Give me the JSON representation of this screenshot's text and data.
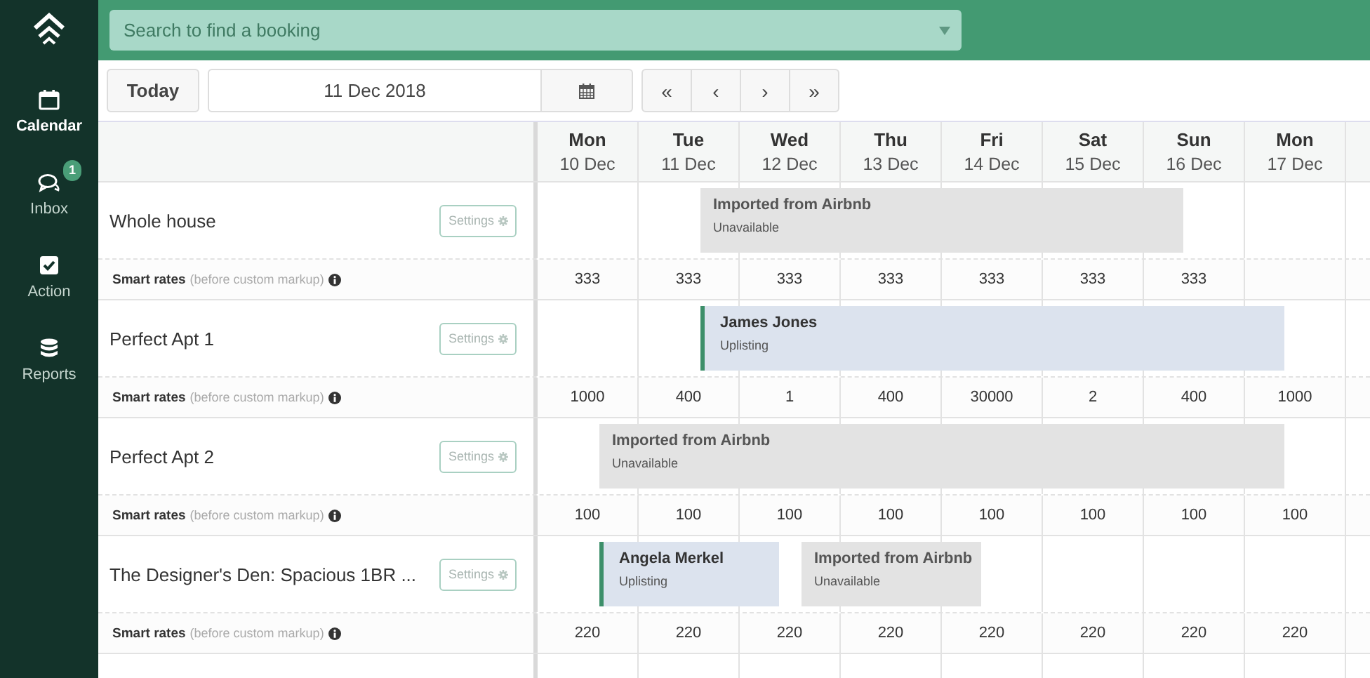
{
  "sidebar": {
    "items": [
      {
        "label": "Calendar",
        "selected": true
      },
      {
        "label": "Inbox",
        "selected": false,
        "badge": "1"
      },
      {
        "label": "Action",
        "selected": false
      },
      {
        "label": "Reports",
        "selected": false
      }
    ]
  },
  "search": {
    "placeholder": "Search to find a booking"
  },
  "toolbar": {
    "today": "Today",
    "date": "11 Dec 2018",
    "nav": [
      "«",
      "‹",
      "›",
      "»"
    ]
  },
  "days": [
    {
      "weekday": "Mon",
      "date": "10 Dec"
    },
    {
      "weekday": "Tue",
      "date": "11 Dec"
    },
    {
      "weekday": "Wed",
      "date": "12 Dec"
    },
    {
      "weekday": "Thu",
      "date": "13 Dec"
    },
    {
      "weekday": "Fri",
      "date": "14 Dec"
    },
    {
      "weekday": "Sat",
      "date": "15 Dec"
    },
    {
      "weekday": "Sun",
      "date": "16 Dec"
    },
    {
      "weekday": "Mon",
      "date": "17 Dec"
    }
  ],
  "listings": [
    {
      "name": "Whole house",
      "settings": "Settings",
      "rates_label": "Smart rates",
      "rates_note": "(before custom markup)",
      "nights": [
        {
          "rate": "333",
          "booked": false
        },
        {
          "rate": "333",
          "booked": true,
          "booking": {
            "kind": "imported",
            "title": "Imported from Airbnb",
            "subtitle": "Unavailable"
          }
        },
        {
          "rate": "333",
          "booked": true
        },
        {
          "rate": "333",
          "booked": true
        },
        {
          "rate": "333",
          "booked": true
        },
        {
          "rate": "333",
          "booked": true
        },
        {
          "rate": "333",
          "booked": false
        },
        {
          "booked": false
        }
      ]
    },
    {
      "name": "Perfect Apt 1",
      "settings": "Settings",
      "rates_label": "Smart rates",
      "rates_note": "(before custom markup)",
      "nights": [
        {
          "rate": "1000",
          "booked": false
        },
        {
          "rate": "400",
          "booked": true,
          "booking": {
            "kind": "guest",
            "title": "James Jones",
            "subtitle": "Uplisting"
          }
        },
        {
          "rate": "1",
          "booked": true
        },
        {
          "rate": "400",
          "booked": true
        },
        {
          "rate": "30000",
          "booked": true
        },
        {
          "rate": "2",
          "booked": true
        },
        {
          "rate": "400",
          "booked": true
        },
        {
          "rate": "1000",
          "booked": false
        }
      ]
    },
    {
      "name": "Perfect Apt 2",
      "settings": "Settings",
      "rates_label": "Smart rates",
      "rates_note": "(before custom markup)",
      "nights": [
        {
          "rate": "100",
          "booked": true,
          "booking": {
            "kind": "imported",
            "title": "Imported from Airbnb",
            "subtitle": "Unavailable"
          }
        },
        {
          "rate": "100",
          "booked": true
        },
        {
          "rate": "100",
          "booked": true
        },
        {
          "rate": "100",
          "booked": true
        },
        {
          "rate": "100",
          "booked": true
        },
        {
          "rate": "100",
          "booked": true
        },
        {
          "rate": "100",
          "booked": true
        },
        {
          "rate": "100",
          "booked": false
        }
      ]
    },
    {
      "name": "The Designer's Den: Spacious 1BR ...",
      "settings": "Settings",
      "rates_label": "Smart rates",
      "rates_note": "(before custom markup)",
      "nights": [
        {
          "rate": "220",
          "booked": true,
          "booking": {
            "kind": "guest",
            "title": "Angela Merkel",
            "subtitle": "Uplisting"
          }
        },
        {
          "rate": "220",
          "booked": true
        },
        {
          "rate": "220",
          "booked": true,
          "booking": {
            "kind": "imported",
            "title": "Imported from Airbnb",
            "subtitle": "Unavailable"
          }
        },
        {
          "rate": "220",
          "booked": true
        },
        {
          "rate": "220",
          "booked": false
        },
        {
          "rate": "220",
          "booked": false
        },
        {
          "rate": "220",
          "booked": false
        },
        {
          "rate": "220",
          "booked": false
        }
      ]
    }
  ]
}
